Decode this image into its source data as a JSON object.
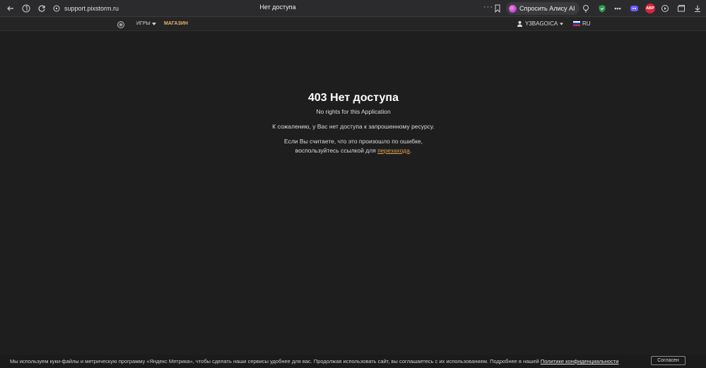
{
  "browser": {
    "url": "support.pixstorm.ru",
    "tab_title": "Нет доступа",
    "alice_label": "Спросить Алису AI",
    "more_label": "···",
    "extensions": [
      {
        "name": "bulb-icon"
      },
      {
        "name": "shield-extension-icon",
        "color": "#2e9a4d"
      },
      {
        "name": "dots-extension-icon"
      },
      {
        "name": "cloud-extension-icon",
        "color": "#6b5cff"
      },
      {
        "name": "adblock-icon",
        "label": "ABP",
        "color": "#d7263d"
      },
      {
        "name": "media-icon"
      },
      {
        "name": "collections-icon"
      },
      {
        "name": "download-icon"
      }
    ]
  },
  "site_nav": {
    "games_label": "ИГРЫ",
    "shop_label": "МАГАЗИН",
    "user_label": "Y3BAGOICA",
    "lang_label": "RU",
    "shop_color": "#e3b56c"
  },
  "error": {
    "title": "403 Нет доступа",
    "subtitle": "No rights for this Application",
    "message": "К сожалению, у Вас нет доступа к запрошенному ресурсу.",
    "hint_line1": "Если Вы считаете, что это произошло по ошибке,",
    "hint_line2_prefix": "воспользуйтесь ссылкой для ",
    "hint_link": "перезахода",
    "hint_suffix": ".",
    "link_color": "#e3a44e"
  },
  "cookie": {
    "text": "Мы используем куки-файлы и метрическую программу «Яндекс Метрика», чтобы сделать наши сервисы удобнее для вас. Продолжая использовать сайт, вы соглашаетесь с их использованием. Подробнее в нашей ",
    "policy_link": "Политике конфиденциальности",
    "accept_label": "Согласен"
  }
}
